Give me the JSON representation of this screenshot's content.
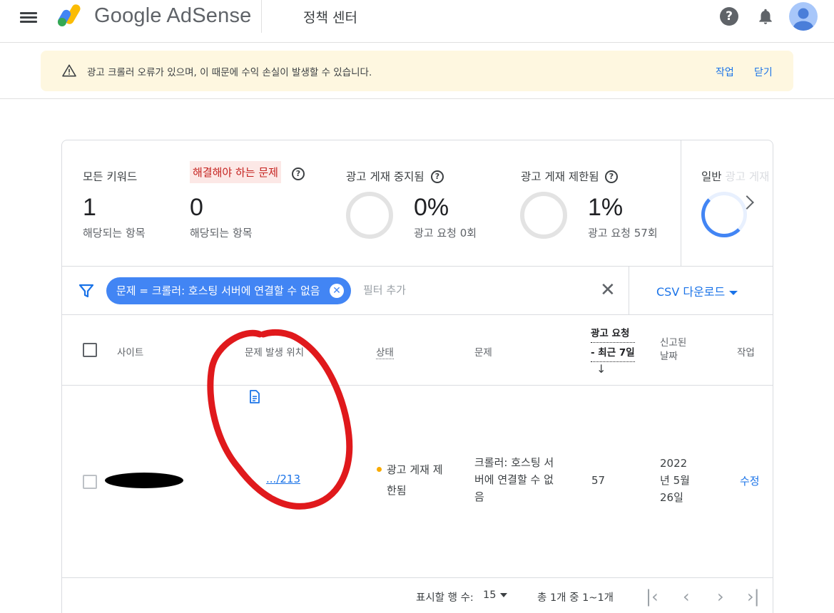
{
  "header": {
    "brand": "Google AdSense",
    "section": "정책 센터",
    "help_glyph": "?"
  },
  "alert": {
    "message": "광고 크롤러 오류가 있으며, 이 때문에 수익 손실이 발생할 수 있습니다.",
    "action_label": "작업",
    "dismiss_label": "닫기"
  },
  "summary": {
    "all_keywords": {
      "label": "모든 키워드",
      "value": "1",
      "sub": "해당되는 항목"
    },
    "issues": {
      "label": "해결해야 하는 문제",
      "value": "0",
      "sub": "해당되는 항목"
    },
    "ads_stopped": {
      "label": "광고 게재 중지됨",
      "value": "0%",
      "sub": "광고 요청 0회"
    },
    "ads_limited": {
      "label": "광고 게재 제한됨",
      "value": "1%",
      "sub": "광고 요청 57회"
    },
    "general": {
      "label": "일반",
      "label_faded": "광고 게재"
    }
  },
  "filter": {
    "chip_label": "문제 = 크롤러: 호스팅 서버에 연결할 수 없음",
    "add_placeholder": "필터 추가",
    "csv_label": "CSV 다운로드"
  },
  "table": {
    "columns": {
      "site": "사이트",
      "location": "문제 발생 위치",
      "status": "상태",
      "issue": "문제",
      "requests_line1": "광고 요청",
      "requests_line2": "- 최근 7일",
      "reported_line1": "신고된",
      "reported_line2": "날짜",
      "action": "작업"
    },
    "rows": [
      {
        "location": ".../213",
        "status_line1": "광고 게재 제",
        "status_line2": "한됨",
        "issue_line1": "크롤러: 호스팅 서",
        "issue_line2": "버에 연결할 수 없",
        "issue_line3": "음",
        "requests": "57",
        "date_line1": "2022",
        "date_line2": "년 5월",
        "date_line3": "26일",
        "action": "수정"
      }
    ]
  },
  "pagination": {
    "rows_label": "표시할 행 수:",
    "rows_value": "15",
    "range": "총 1개 중 1~1개"
  },
  "colors": {
    "accent": "#1a73e8",
    "chip": "#4285f4",
    "alert_bg": "#fef7e0",
    "status_warning": "#f9ab00",
    "issue_highlight": "#fce8e6",
    "annotation": "#e0191c"
  }
}
